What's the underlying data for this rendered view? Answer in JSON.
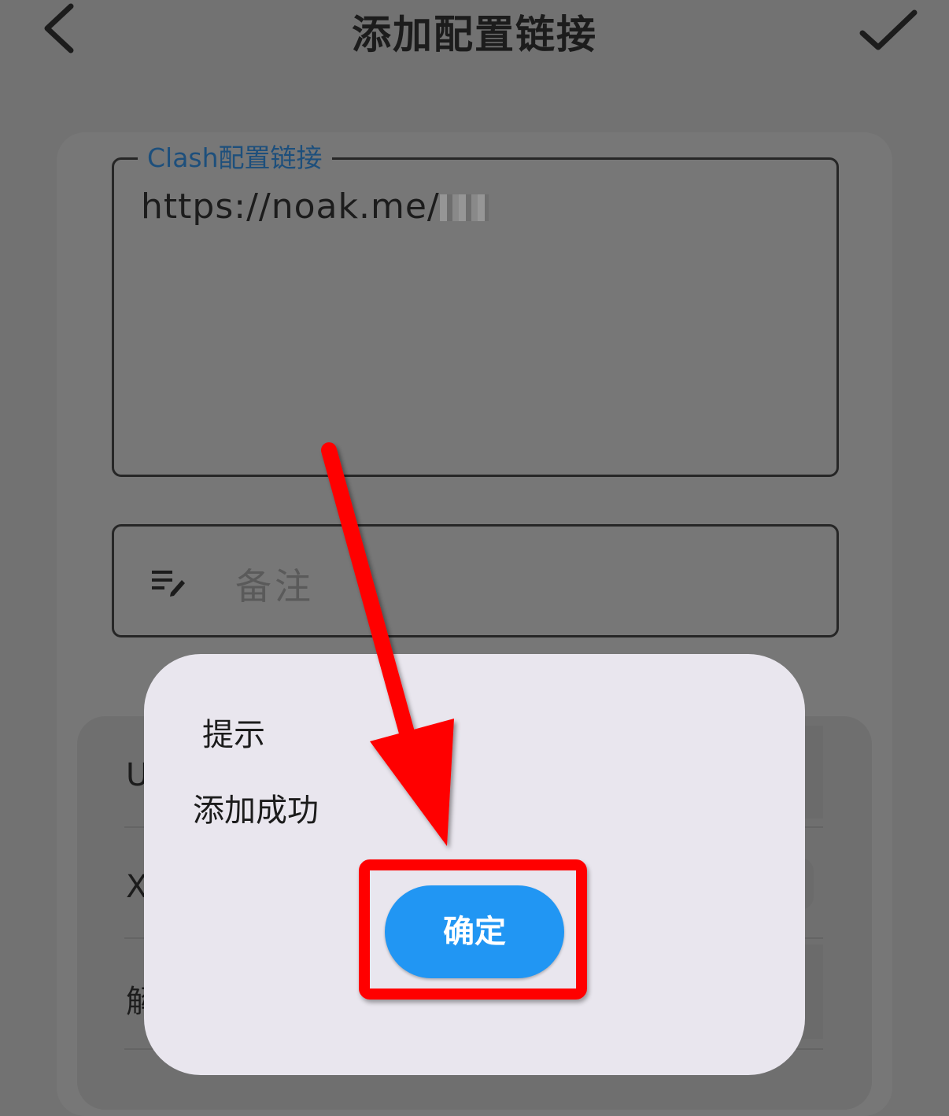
{
  "header": {
    "title": "添加配置链接",
    "back_icon": "chevron-left-icon",
    "confirm_icon": "check-icon"
  },
  "form": {
    "url_label": "Clash配置链接",
    "url_value": "https://noak.me/",
    "url_value_redacted": true,
    "note_icon": "edit-note-icon",
    "note_placeholder": "备注"
  },
  "background_rows": {
    "row1_initial": "U",
    "row2_initial": "X",
    "row3_initial": "解"
  },
  "dialog": {
    "title": "提示",
    "message": "添加成功",
    "ok_label": "确定"
  },
  "colors": {
    "overlay_background": "#727272",
    "dialog_background": "#e9e6ee",
    "primary_button": "#2196f3",
    "annotation_red": "#ff0000",
    "field_label": "#1d4f7c"
  }
}
